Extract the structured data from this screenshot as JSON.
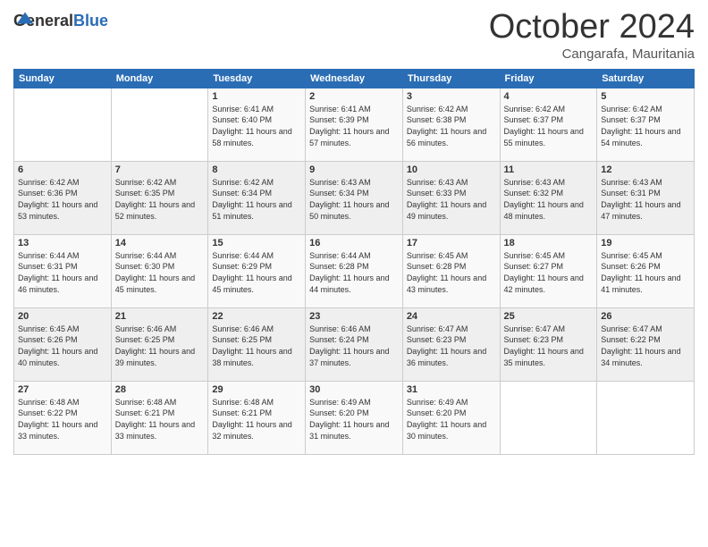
{
  "logo": {
    "general": "General",
    "blue": "Blue"
  },
  "header": {
    "month": "October 2024",
    "location": "Cangarafa, Mauritania"
  },
  "weekdays": [
    "Sunday",
    "Monday",
    "Tuesday",
    "Wednesday",
    "Thursday",
    "Friday",
    "Saturday"
  ],
  "weeks": [
    [
      null,
      null,
      {
        "day": "1",
        "sunrise": "6:41 AM",
        "sunset": "6:40 PM",
        "daylight": "11 hours and 58 minutes."
      },
      {
        "day": "2",
        "sunrise": "6:41 AM",
        "sunset": "6:39 PM",
        "daylight": "11 hours and 57 minutes."
      },
      {
        "day": "3",
        "sunrise": "6:42 AM",
        "sunset": "6:38 PM",
        "daylight": "11 hours and 56 minutes."
      },
      {
        "day": "4",
        "sunrise": "6:42 AM",
        "sunset": "6:37 PM",
        "daylight": "11 hours and 55 minutes."
      },
      {
        "day": "5",
        "sunrise": "6:42 AM",
        "sunset": "6:37 PM",
        "daylight": "11 hours and 54 minutes."
      }
    ],
    [
      {
        "day": "6",
        "sunrise": "6:42 AM",
        "sunset": "6:36 PM",
        "daylight": "11 hours and 53 minutes."
      },
      {
        "day": "7",
        "sunrise": "6:42 AM",
        "sunset": "6:35 PM",
        "daylight": "11 hours and 52 minutes."
      },
      {
        "day": "8",
        "sunrise": "6:42 AM",
        "sunset": "6:34 PM",
        "daylight": "11 hours and 51 minutes."
      },
      {
        "day": "9",
        "sunrise": "6:43 AM",
        "sunset": "6:34 PM",
        "daylight": "11 hours and 50 minutes."
      },
      {
        "day": "10",
        "sunrise": "6:43 AM",
        "sunset": "6:33 PM",
        "daylight": "11 hours and 49 minutes."
      },
      {
        "day": "11",
        "sunrise": "6:43 AM",
        "sunset": "6:32 PM",
        "daylight": "11 hours and 48 minutes."
      },
      {
        "day": "12",
        "sunrise": "6:43 AM",
        "sunset": "6:31 PM",
        "daylight": "11 hours and 47 minutes."
      }
    ],
    [
      {
        "day": "13",
        "sunrise": "6:44 AM",
        "sunset": "6:31 PM",
        "daylight": "11 hours and 46 minutes."
      },
      {
        "day": "14",
        "sunrise": "6:44 AM",
        "sunset": "6:30 PM",
        "daylight": "11 hours and 45 minutes."
      },
      {
        "day": "15",
        "sunrise": "6:44 AM",
        "sunset": "6:29 PM",
        "daylight": "11 hours and 45 minutes."
      },
      {
        "day": "16",
        "sunrise": "6:44 AM",
        "sunset": "6:28 PM",
        "daylight": "11 hours and 44 minutes."
      },
      {
        "day": "17",
        "sunrise": "6:45 AM",
        "sunset": "6:28 PM",
        "daylight": "11 hours and 43 minutes."
      },
      {
        "day": "18",
        "sunrise": "6:45 AM",
        "sunset": "6:27 PM",
        "daylight": "11 hours and 42 minutes."
      },
      {
        "day": "19",
        "sunrise": "6:45 AM",
        "sunset": "6:26 PM",
        "daylight": "11 hours and 41 minutes."
      }
    ],
    [
      {
        "day": "20",
        "sunrise": "6:45 AM",
        "sunset": "6:26 PM",
        "daylight": "11 hours and 40 minutes."
      },
      {
        "day": "21",
        "sunrise": "6:46 AM",
        "sunset": "6:25 PM",
        "daylight": "11 hours and 39 minutes."
      },
      {
        "day": "22",
        "sunrise": "6:46 AM",
        "sunset": "6:25 PM",
        "daylight": "11 hours and 38 minutes."
      },
      {
        "day": "23",
        "sunrise": "6:46 AM",
        "sunset": "6:24 PM",
        "daylight": "11 hours and 37 minutes."
      },
      {
        "day": "24",
        "sunrise": "6:47 AM",
        "sunset": "6:23 PM",
        "daylight": "11 hours and 36 minutes."
      },
      {
        "day": "25",
        "sunrise": "6:47 AM",
        "sunset": "6:23 PM",
        "daylight": "11 hours and 35 minutes."
      },
      {
        "day": "26",
        "sunrise": "6:47 AM",
        "sunset": "6:22 PM",
        "daylight": "11 hours and 34 minutes."
      }
    ],
    [
      {
        "day": "27",
        "sunrise": "6:48 AM",
        "sunset": "6:22 PM",
        "daylight": "11 hours and 33 minutes."
      },
      {
        "day": "28",
        "sunrise": "6:48 AM",
        "sunset": "6:21 PM",
        "daylight": "11 hours and 33 minutes."
      },
      {
        "day": "29",
        "sunrise": "6:48 AM",
        "sunset": "6:21 PM",
        "daylight": "11 hours and 32 minutes."
      },
      {
        "day": "30",
        "sunrise": "6:49 AM",
        "sunset": "6:20 PM",
        "daylight": "11 hours and 31 minutes."
      },
      {
        "day": "31",
        "sunrise": "6:49 AM",
        "sunset": "6:20 PM",
        "daylight": "11 hours and 30 minutes."
      },
      null,
      null
    ]
  ],
  "labels": {
    "sunrise": "Sunrise: ",
    "sunset": "Sunset: ",
    "daylight": "Daylight: "
  }
}
